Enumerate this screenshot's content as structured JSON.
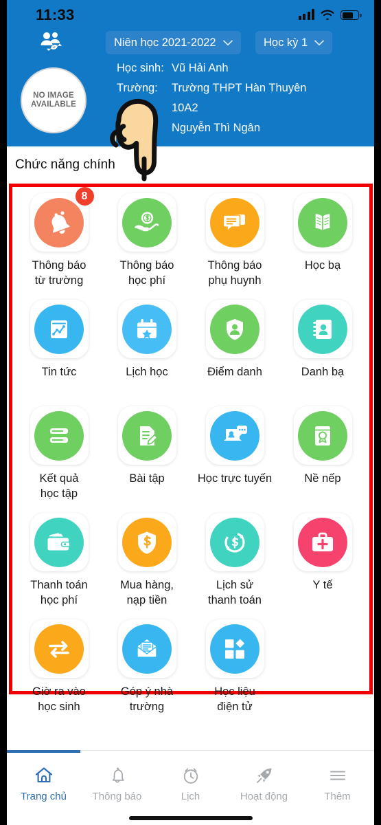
{
  "app": {
    "brand_color": "#1279C6",
    "highlight_color": "#F20000",
    "accent_color": "#2E6DB4"
  },
  "status_bar": {
    "time": "11:33",
    "signal_icon": "cellular-signal-icon",
    "wifi_icon": "wifi-icon",
    "battery_icon": "battery-icon"
  },
  "header": {
    "switch_account_icon": "switch-account-icon",
    "school_year": {
      "label": "Niên học 2021-2022",
      "chevron": "chevron-down-icon"
    },
    "semester": {
      "label": "Học kỳ 1",
      "chevron": "chevron-down-icon"
    },
    "avatar": {
      "line1": "NO IMAGE",
      "line2": "AVAILABLE"
    },
    "student_key": "Học sinh:",
    "student_value": "Vũ Hải Anh",
    "school_key": "Trường:",
    "school_value": "Trường THPT  Hàn Thuyên",
    "class_value": "10A2",
    "teacher_value": "Nguyễn Thì Ngân"
  },
  "section": {
    "title": "Chức năng chính"
  },
  "functions": [
    {
      "label": "Thông báo\ntừ trường",
      "icon": "bell-icon",
      "color": "#F4845F",
      "badge": "8"
    },
    {
      "label": "Thông báo\nhọc phí",
      "icon": "money-hand-icon",
      "color": "#6FCF60",
      "badge": ""
    },
    {
      "label": "Thông báo\nphụ huynh",
      "icon": "chat-bubbles-icon",
      "color": "#FBA91B",
      "badge": ""
    },
    {
      "label": "Học bạ",
      "icon": "open-book-icon",
      "color": "#6FCF60",
      "badge": ""
    },
    {
      "label": "Tin tức",
      "icon": "news-chart-icon",
      "color": "#37B6F0",
      "badge": ""
    },
    {
      "label": "Lịch học",
      "icon": "calendar-star-icon",
      "color": "#46BDF4",
      "badge": ""
    },
    {
      "label": "Điểm danh",
      "icon": "shield-person-icon",
      "color": "#6FCF60",
      "badge": ""
    },
    {
      "label": "Danh bạ",
      "icon": "contact-book-icon",
      "color": "#3FD3C0",
      "badge": ""
    },
    {
      "label": "Kết quả\nhọc tập",
      "icon": "results-list-icon",
      "color": "#6FCF60",
      "badge": ""
    },
    {
      "label": "Bài tập",
      "icon": "homework-edit-icon",
      "color": "#6FCF60",
      "badge": ""
    },
    {
      "label": "Học trực tuyến",
      "icon": "online-class-icon",
      "color": "#37B6F0",
      "badge": ""
    },
    {
      "label": "Nề nếp",
      "icon": "conduct-award-icon",
      "color": "#6FCF60",
      "badge": ""
    },
    {
      "label": "Thanh toán\nhọc phí",
      "icon": "wallet-icon",
      "color": "#3FD3C0",
      "badge": ""
    },
    {
      "label": "Mua hàng,\nnạp tiền",
      "icon": "shield-dollar-icon",
      "color": "#FBA91B",
      "badge": ""
    },
    {
      "label": "Lịch sử\nthanh toán",
      "icon": "payment-history-icon",
      "color": "#3FD3C0",
      "badge": ""
    },
    {
      "label": "Y tế",
      "icon": "medical-kit-icon",
      "color": "#F5436E",
      "badge": ""
    },
    {
      "label": "Giờ ra vào\nhọc sinh",
      "icon": "check-inout-icon",
      "color": "#FBA91B",
      "badge": ""
    },
    {
      "label": "Góp ý nhà\ntrường",
      "icon": "envelope-icon",
      "color": "#37B6F0",
      "badge": ""
    },
    {
      "label": "Học liệu\nđiện tử",
      "icon": "grid-blocks-icon",
      "color": "#37B6F0",
      "badge": ""
    }
  ],
  "bottom_nav": [
    {
      "label": "Trang chủ",
      "icon": "home-icon",
      "active": true
    },
    {
      "label": "Thông báo",
      "icon": "bell-icon",
      "active": false
    },
    {
      "label": "Lịch",
      "icon": "alarm-icon",
      "active": false
    },
    {
      "label": "Hoạt động",
      "icon": "rocket-icon",
      "active": false
    },
    {
      "label": "Thêm",
      "icon": "hamburger-icon",
      "active": false
    }
  ]
}
